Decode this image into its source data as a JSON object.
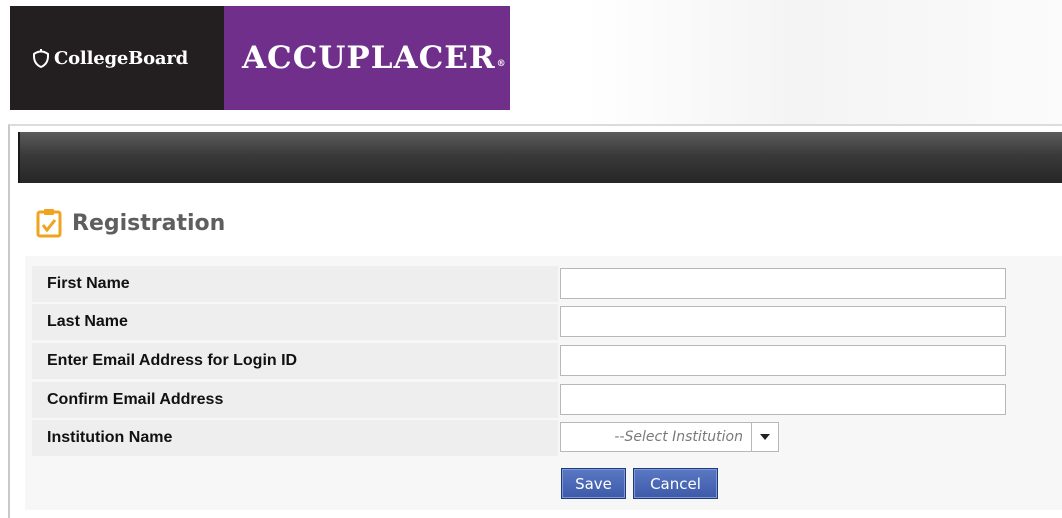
{
  "branding": {
    "college_board": "CollegeBoard",
    "accuplacer": "ACCUPLACER",
    "registered_mark": "®",
    "colors": {
      "college_board_bg": "#231f20",
      "accuplacer_bg": "#702f8a"
    }
  },
  "page": {
    "title": "Registration",
    "icon": "clipboard-check-icon"
  },
  "form": {
    "fields": [
      {
        "label": "First Name",
        "value": ""
      },
      {
        "label": "Last Name",
        "value": ""
      },
      {
        "label": "Enter Email Address for Login ID",
        "value": ""
      },
      {
        "label": "Confirm Email Address",
        "value": ""
      }
    ],
    "institution": {
      "label": "Institution Name",
      "placeholder": "--Select Institution"
    },
    "buttons": {
      "save": "Save",
      "cancel": "Cancel",
      "color": "#3c5aa8"
    }
  }
}
